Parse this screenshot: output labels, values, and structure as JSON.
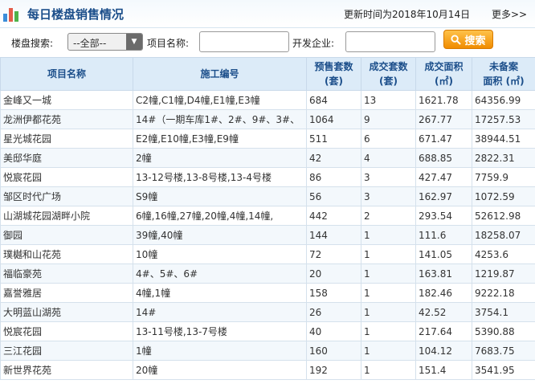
{
  "header": {
    "title": "每日楼盘销售情况",
    "updated": "更新时间为2018年10月14日",
    "more": "更多>>"
  },
  "search": {
    "label_project_search": "楼盘搜索:",
    "select_value": "--全部--",
    "label_project_name": "项目名称:",
    "project_name_value": "",
    "label_developer": "开发企业:",
    "developer_value": "",
    "button_label": "搜索"
  },
  "table": {
    "headers": {
      "name": "项目名称",
      "code": "施工编号",
      "presale_line1": "预售套数",
      "presale_line2": "(套)",
      "deal_line1": "成交套数",
      "deal_line2": "(套)",
      "area_line1": "成交面积",
      "area_line2": "(㎡)",
      "unfiled_line1": "未备案",
      "unfiled_line2": "面积 (㎡)"
    },
    "rows": [
      {
        "name": "金峰又一城",
        "code": "C2幢,C1幢,D4幢,E1幢,E3幢",
        "presale": "684",
        "deal": "13",
        "area": "1621.78",
        "unfiled": "64356.99"
      },
      {
        "name": "龙洲伊都花苑",
        "code": "14#（一期车库1#、2#、9#、3#、",
        "presale": "1064",
        "deal": "9",
        "area": "267.77",
        "unfiled": "17257.53"
      },
      {
        "name": "星光城花园",
        "code": "E2幢,E10幢,E3幢,E9幢",
        "presale": "511",
        "deal": "6",
        "area": "671.47",
        "unfiled": "38944.51"
      },
      {
        "name": "美邸华庭",
        "code": "2幢",
        "presale": "42",
        "deal": "4",
        "area": "688.85",
        "unfiled": "2822.31"
      },
      {
        "name": "悦宸花园",
        "code": "13-12号楼,13-8号楼,13-4号楼",
        "presale": "86",
        "deal": "3",
        "area": "427.47",
        "unfiled": "7759.9"
      },
      {
        "name": "邹区时代广场",
        "code": "S9幢",
        "presale": "56",
        "deal": "3",
        "area": "162.97",
        "unfiled": "1072.59"
      },
      {
        "name": "山湖城花园湖畔小院",
        "code": "6幢,16幢,27幢,20幢,4幢,14幢,",
        "presale": "442",
        "deal": "2",
        "area": "293.54",
        "unfiled": "52612.98"
      },
      {
        "name": "御园",
        "code": "39幢,40幢",
        "presale": "144",
        "deal": "1",
        "area": "111.6",
        "unfiled": "18258.07"
      },
      {
        "name": "璞樾和山花苑",
        "code": "10幢",
        "presale": "72",
        "deal": "1",
        "area": "141.05",
        "unfiled": "4253.6"
      },
      {
        "name": "福临豪苑",
        "code": "4#、5#、6#",
        "presale": "20",
        "deal": "1",
        "area": "163.81",
        "unfiled": "1219.87"
      },
      {
        "name": "嘉誉雅居",
        "code": "4幢,1幢",
        "presale": "158",
        "deal": "1",
        "area": "182.46",
        "unfiled": "9222.18"
      },
      {
        "name": "大明蓝山湖苑",
        "code": "14#",
        "presale": "26",
        "deal": "1",
        "area": "42.52",
        "unfiled": "3754.1"
      },
      {
        "name": "悦宸花园",
        "code": "13-11号楼,13-7号楼",
        "presale": "40",
        "deal": "1",
        "area": "217.64",
        "unfiled": "5390.88"
      },
      {
        "name": "三江花园",
        "code": "1幢",
        "presale": "160",
        "deal": "1",
        "area": "104.12",
        "unfiled": "7683.75"
      },
      {
        "name": "新世界花苑",
        "code": "20幢",
        "presale": "192",
        "deal": "1",
        "area": "151.4",
        "unfiled": "3541.95"
      }
    ]
  },
  "colors": {
    "title": "#1b4e8a",
    "header_bg": "#dcebf8",
    "search_button": "#f08c00"
  }
}
